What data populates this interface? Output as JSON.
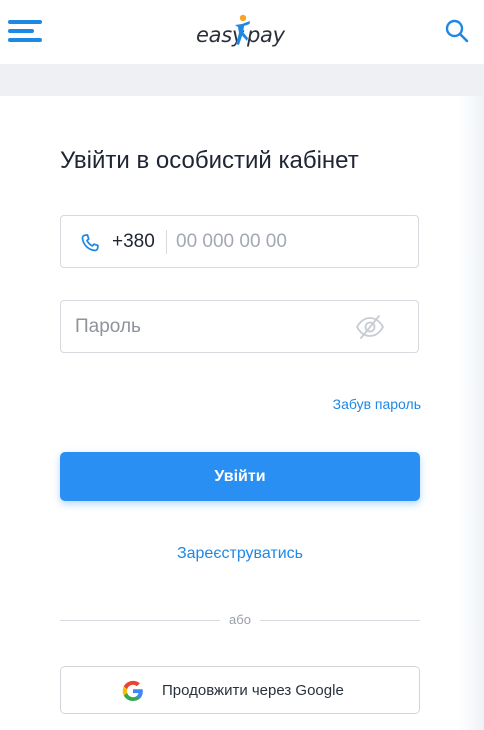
{
  "header": {
    "logo_left": "easy",
    "logo_right": "pay",
    "menu_icon": "hamburger-menu-icon",
    "search_icon": "search-icon"
  },
  "login": {
    "title": "Увійти в особистий кабінет",
    "phone": {
      "icon": "phone-icon",
      "prefix": "+380",
      "placeholder": "00 000 00 00",
      "value": ""
    },
    "password": {
      "placeholder": "Пароль",
      "value": "",
      "toggle_icon": "eye-off-icon"
    },
    "forgot_label": "Забув пароль",
    "submit_label": "Увійти",
    "register_label": "Зареєструватись",
    "divider_label": "або",
    "google_label": "Продовжити через Google",
    "google_icon": "google-icon"
  },
  "colors": {
    "accent": "#1e88e5",
    "button": "#2a8ff2",
    "band": "#eef0f4",
    "border": "#d6d9de"
  }
}
